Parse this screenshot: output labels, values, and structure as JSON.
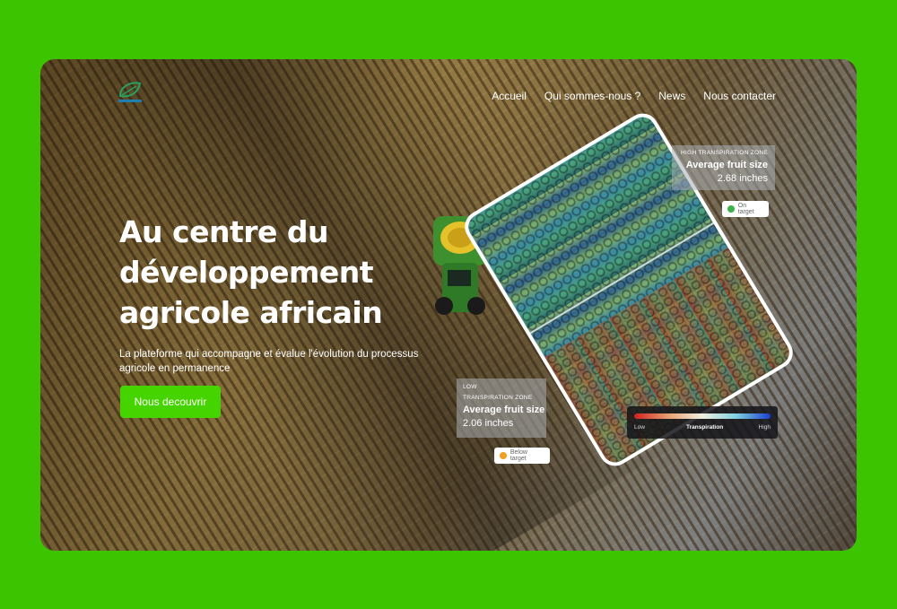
{
  "nav": {
    "items": [
      "Accueil",
      "Qui sommes-nous ?",
      "News",
      "Nous contacter"
    ]
  },
  "hero": {
    "title": "Au centre du développement agricole africain",
    "subtitle": "La plateforme qui accompagne et évalue l'évolution du processus agricole en permanence",
    "cta_label": "Nous decouvrir"
  },
  "overlay": {
    "high_zone": {
      "label": "HIGH TRANSPIRATION ZONE",
      "metric": "Average fruit size",
      "value": "2.68 inches",
      "status": "On target",
      "status_color": "#3cb34a"
    },
    "low_zone": {
      "label_line1": "LOW",
      "label_line2": "TRANSPIRATION ZONE",
      "metric": "Average fruit size",
      "value": "2.06 inches",
      "status": "Below target",
      "status_color": "#f0a020"
    },
    "legend": {
      "low": "Low",
      "title": "Transpiration",
      "high": "High"
    }
  },
  "colors": {
    "page_bg": "#3dc400",
    "cta_bg": "#46d400"
  },
  "icons": {
    "logo": "leaf-logo-icon",
    "on_target": "check-circle-icon",
    "below_target": "warning-dot-icon"
  }
}
